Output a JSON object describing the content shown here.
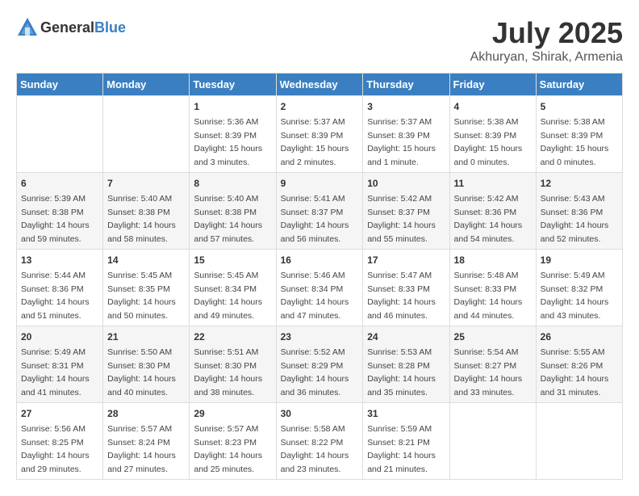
{
  "header": {
    "logo_general": "General",
    "logo_blue": "Blue",
    "month": "July 2025",
    "location": "Akhuryan, Shirak, Armenia"
  },
  "days_of_week": [
    "Sunday",
    "Monday",
    "Tuesday",
    "Wednesday",
    "Thursday",
    "Friday",
    "Saturday"
  ],
  "weeks": [
    [
      {
        "day": "",
        "info": ""
      },
      {
        "day": "",
        "info": ""
      },
      {
        "day": "1",
        "info": "Sunrise: 5:36 AM\nSunset: 8:39 PM\nDaylight: 15 hours\nand 3 minutes."
      },
      {
        "day": "2",
        "info": "Sunrise: 5:37 AM\nSunset: 8:39 PM\nDaylight: 15 hours\nand 2 minutes."
      },
      {
        "day": "3",
        "info": "Sunrise: 5:37 AM\nSunset: 8:39 PM\nDaylight: 15 hours\nand 1 minute."
      },
      {
        "day": "4",
        "info": "Sunrise: 5:38 AM\nSunset: 8:39 PM\nDaylight: 15 hours\nand 0 minutes."
      },
      {
        "day": "5",
        "info": "Sunrise: 5:38 AM\nSunset: 8:39 PM\nDaylight: 15 hours\nand 0 minutes."
      }
    ],
    [
      {
        "day": "6",
        "info": "Sunrise: 5:39 AM\nSunset: 8:38 PM\nDaylight: 14 hours\nand 59 minutes."
      },
      {
        "day": "7",
        "info": "Sunrise: 5:40 AM\nSunset: 8:38 PM\nDaylight: 14 hours\nand 58 minutes."
      },
      {
        "day": "8",
        "info": "Sunrise: 5:40 AM\nSunset: 8:38 PM\nDaylight: 14 hours\nand 57 minutes."
      },
      {
        "day": "9",
        "info": "Sunrise: 5:41 AM\nSunset: 8:37 PM\nDaylight: 14 hours\nand 56 minutes."
      },
      {
        "day": "10",
        "info": "Sunrise: 5:42 AM\nSunset: 8:37 PM\nDaylight: 14 hours\nand 55 minutes."
      },
      {
        "day": "11",
        "info": "Sunrise: 5:42 AM\nSunset: 8:36 PM\nDaylight: 14 hours\nand 54 minutes."
      },
      {
        "day": "12",
        "info": "Sunrise: 5:43 AM\nSunset: 8:36 PM\nDaylight: 14 hours\nand 52 minutes."
      }
    ],
    [
      {
        "day": "13",
        "info": "Sunrise: 5:44 AM\nSunset: 8:36 PM\nDaylight: 14 hours\nand 51 minutes."
      },
      {
        "day": "14",
        "info": "Sunrise: 5:45 AM\nSunset: 8:35 PM\nDaylight: 14 hours\nand 50 minutes."
      },
      {
        "day": "15",
        "info": "Sunrise: 5:45 AM\nSunset: 8:34 PM\nDaylight: 14 hours\nand 49 minutes."
      },
      {
        "day": "16",
        "info": "Sunrise: 5:46 AM\nSunset: 8:34 PM\nDaylight: 14 hours\nand 47 minutes."
      },
      {
        "day": "17",
        "info": "Sunrise: 5:47 AM\nSunset: 8:33 PM\nDaylight: 14 hours\nand 46 minutes."
      },
      {
        "day": "18",
        "info": "Sunrise: 5:48 AM\nSunset: 8:33 PM\nDaylight: 14 hours\nand 44 minutes."
      },
      {
        "day": "19",
        "info": "Sunrise: 5:49 AM\nSunset: 8:32 PM\nDaylight: 14 hours\nand 43 minutes."
      }
    ],
    [
      {
        "day": "20",
        "info": "Sunrise: 5:49 AM\nSunset: 8:31 PM\nDaylight: 14 hours\nand 41 minutes."
      },
      {
        "day": "21",
        "info": "Sunrise: 5:50 AM\nSunset: 8:30 PM\nDaylight: 14 hours\nand 40 minutes."
      },
      {
        "day": "22",
        "info": "Sunrise: 5:51 AM\nSunset: 8:30 PM\nDaylight: 14 hours\nand 38 minutes."
      },
      {
        "day": "23",
        "info": "Sunrise: 5:52 AM\nSunset: 8:29 PM\nDaylight: 14 hours\nand 36 minutes."
      },
      {
        "day": "24",
        "info": "Sunrise: 5:53 AM\nSunset: 8:28 PM\nDaylight: 14 hours\nand 35 minutes."
      },
      {
        "day": "25",
        "info": "Sunrise: 5:54 AM\nSunset: 8:27 PM\nDaylight: 14 hours\nand 33 minutes."
      },
      {
        "day": "26",
        "info": "Sunrise: 5:55 AM\nSunset: 8:26 PM\nDaylight: 14 hours\nand 31 minutes."
      }
    ],
    [
      {
        "day": "27",
        "info": "Sunrise: 5:56 AM\nSunset: 8:25 PM\nDaylight: 14 hours\nand 29 minutes."
      },
      {
        "day": "28",
        "info": "Sunrise: 5:57 AM\nSunset: 8:24 PM\nDaylight: 14 hours\nand 27 minutes."
      },
      {
        "day": "29",
        "info": "Sunrise: 5:57 AM\nSunset: 8:23 PM\nDaylight: 14 hours\nand 25 minutes."
      },
      {
        "day": "30",
        "info": "Sunrise: 5:58 AM\nSunset: 8:22 PM\nDaylight: 14 hours\nand 23 minutes."
      },
      {
        "day": "31",
        "info": "Sunrise: 5:59 AM\nSunset: 8:21 PM\nDaylight: 14 hours\nand 21 minutes."
      },
      {
        "day": "",
        "info": ""
      },
      {
        "day": "",
        "info": ""
      }
    ]
  ]
}
